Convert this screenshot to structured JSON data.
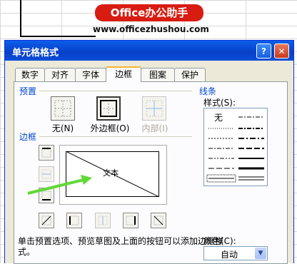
{
  "watermark": {
    "brand": "Office办公助手",
    "url": "www.officezhushou.com"
  },
  "dialog": {
    "title": "单元格格式",
    "help_label": "?",
    "close_label": "✕",
    "tabs": [
      "数字",
      "对齐",
      "字体",
      "边框",
      "图案",
      "保护"
    ],
    "active_tab": "边框"
  },
  "presets": {
    "group_label": "预置",
    "items": [
      {
        "label": "无(N)",
        "icon": "border-none-icon",
        "enabled": true
      },
      {
        "label": "外边框(O)",
        "icon": "border-outline-icon",
        "enabled": true
      },
      {
        "label": "内部(I)",
        "icon": "border-inside-icon",
        "enabled": false
      }
    ]
  },
  "border": {
    "group_label": "边框",
    "preview_text": "文本",
    "buttons": [
      "border-top-icon",
      "border-inner-horizontal-icon",
      "border-bottom-icon",
      "border-diagonal-up-icon",
      "border-left-icon",
      "border-inner-vertical-icon",
      "border-right-icon",
      "border-diagonal-down-icon"
    ]
  },
  "line": {
    "group_label": "线条",
    "style_label": "样式(S):",
    "none_label": "无",
    "color_label": "颜色(C):",
    "color_value": "自动"
  },
  "hint": "单击预置选项、预览草图及上面的按钮可以添加边框样式。",
  "colors": {
    "title_bar": "#0a4fd9",
    "dialog_bg": "#ece9d8",
    "accent_tab": "#f5b43c",
    "arrow": "#62d838",
    "banner": "#d81c12"
  }
}
